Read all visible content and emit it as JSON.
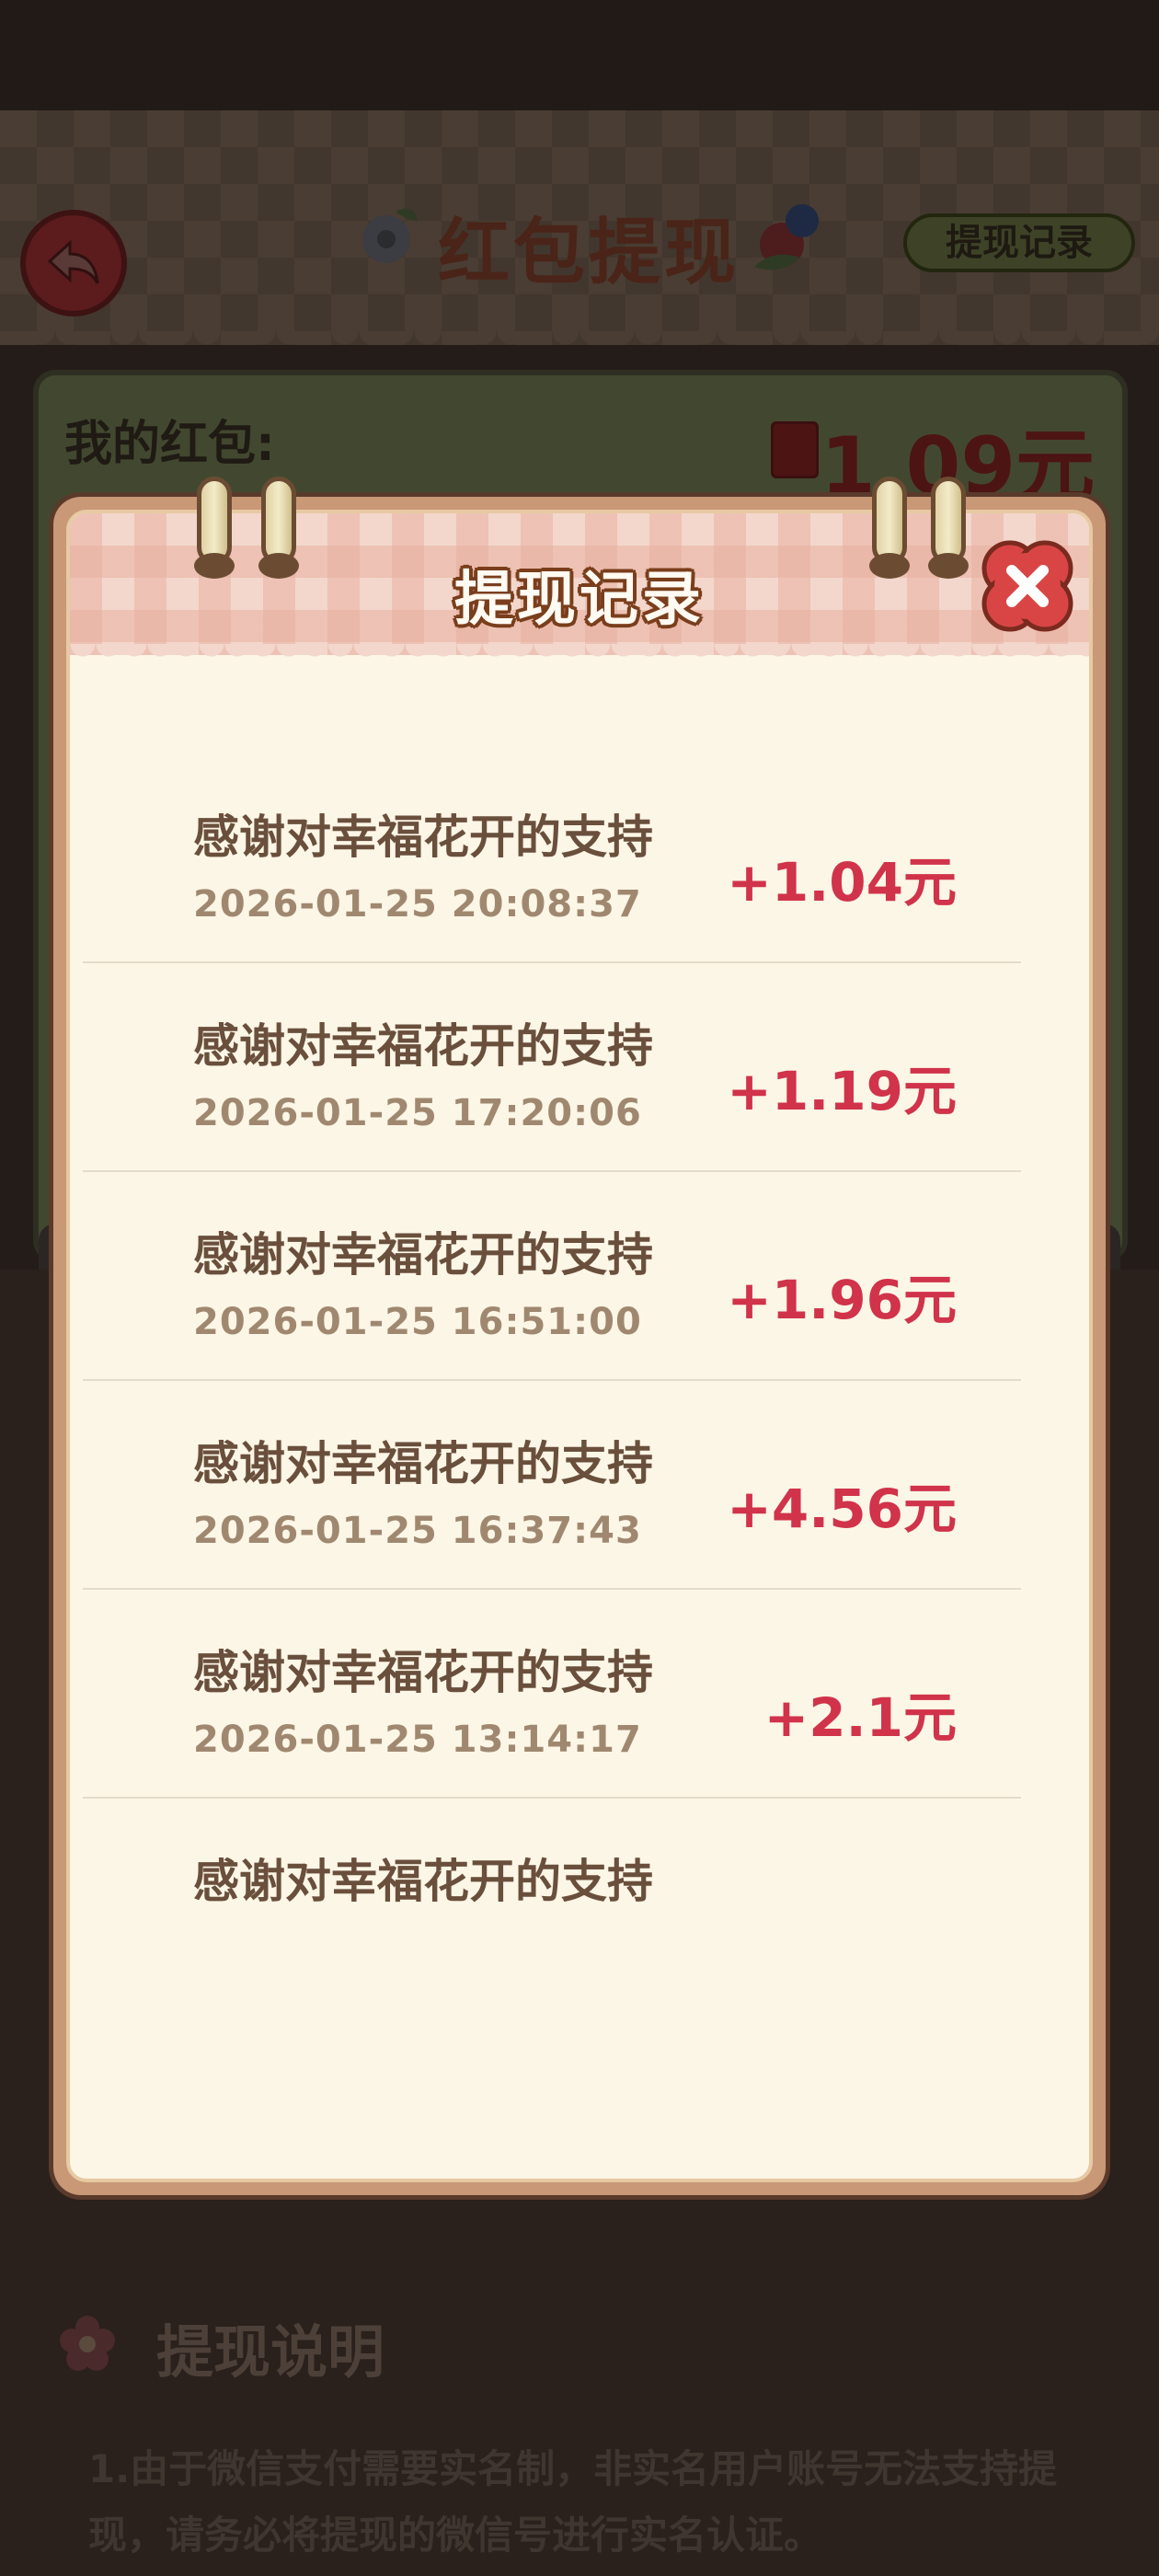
{
  "header": {
    "title": "红包提现",
    "records_link": "提现记录"
  },
  "wallet": {
    "label": "我的红包:",
    "amount": "1.09元"
  },
  "modal": {
    "title": "提现记录",
    "records": [
      {
        "desc": "感谢对幸福花开的支持",
        "time": "2026-01-25 20:08:37",
        "amount": "+1.04元"
      },
      {
        "desc": "感谢对幸福花开的支持",
        "time": "2026-01-25 17:20:06",
        "amount": "+1.19元"
      },
      {
        "desc": "感谢对幸福花开的支持",
        "time": "2026-01-25 16:51:00",
        "amount": "+1.96元"
      },
      {
        "desc": "感谢对幸福花开的支持",
        "time": "2026-01-25 16:37:43",
        "amount": "+4.56元"
      },
      {
        "desc": "感谢对幸福花开的支持",
        "time": "2026-01-25 13:14:17",
        "amount": "+2.1元"
      },
      {
        "desc": "感谢对幸福花开的支持",
        "time": "",
        "amount": ""
      }
    ]
  },
  "instructions": {
    "title": "提现说明",
    "text": "1.由于微信支付需要实名制，非实名用户账号无法支持提现，请务必将提现的微信号进行实名认证。"
  },
  "colors": {
    "amount_red": "#d0334a",
    "modal_bg": "#fcf6e6",
    "modal_border": "#c99877"
  }
}
